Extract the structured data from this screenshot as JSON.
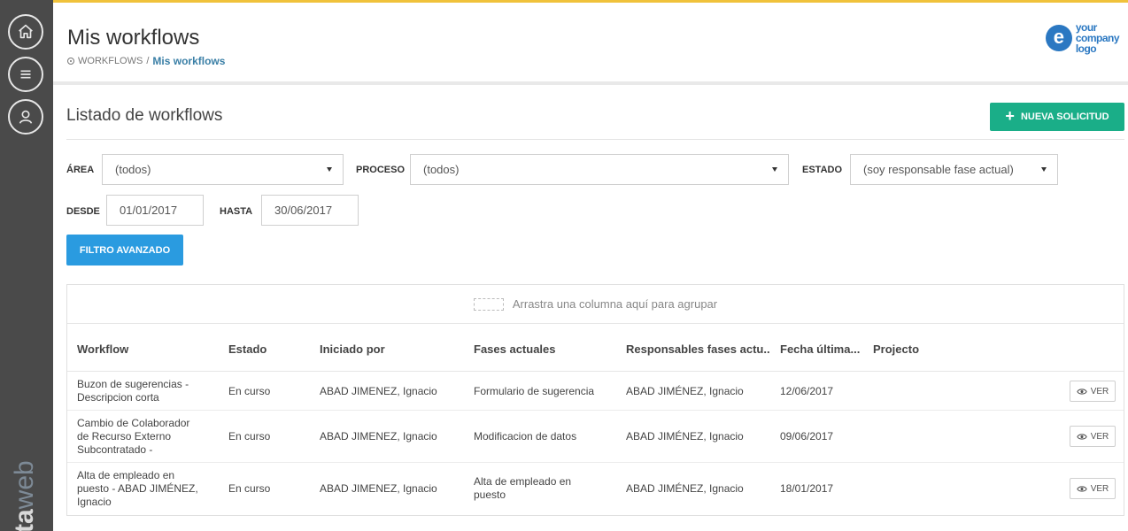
{
  "header": {
    "title": "Mis workflows",
    "breadcrumb_root": "WORKFLOWS",
    "breadcrumb_sep": "/",
    "breadcrumb_current": "Mis workflows",
    "logo_lines": [
      "your",
      "company",
      "logo"
    ],
    "logo_mark": "e"
  },
  "sidebar": {
    "icons": [
      "home-icon",
      "menu-icon",
      "user-icon"
    ],
    "brand_bold": "ta",
    "brand_light": "web"
  },
  "section": {
    "title": "Listado de workflows",
    "new_button": "NUEVA SOLICITUD",
    "new_button_icon": "+"
  },
  "filters": {
    "area_label": "ÁREA",
    "area_value": "(todos)",
    "proceso_label": "PROCESO",
    "proceso_value": "(todos)",
    "estado_label": "ESTADO",
    "estado_value": "(soy responsable fase actual)",
    "desde_label": "DESDE",
    "desde_value": "01/01/2017",
    "hasta_label": "HASTA",
    "hasta_value": "30/06/2017",
    "advanced_button": "FILTRO AVANZADO"
  },
  "grid": {
    "group_hint": "Arrastra una columna aquí para agrupar",
    "columns": [
      "Workflow",
      "Estado",
      "Iniciado por",
      "Fases actuales",
      "Responsables fases actu..",
      "Fecha última...",
      "Projecto"
    ],
    "view_label": "VER",
    "rows": [
      {
        "workflow": [
          "Buzon de sugerencias -",
          "Descripcion corta"
        ],
        "estado": "En curso",
        "iniciado": "ABAD JIMENEZ, Ignacio",
        "fases": [
          "Formulario de sugerencia"
        ],
        "responsables": "ABAD JIMÉNEZ, Ignacio",
        "fecha": "12/06/2017",
        "projecto": ""
      },
      {
        "workflow": [
          "Cambio de Colaborador",
          "de Recurso Externo",
          "Subcontratado -"
        ],
        "estado": "En curso",
        "iniciado": "ABAD JIMENEZ, Ignacio",
        "fases": [
          "Modificacion de datos"
        ],
        "responsables": "ABAD JIMÉNEZ, Ignacio",
        "fecha": "09/06/2017",
        "projecto": ""
      },
      {
        "workflow": [
          "Alta de empleado en",
          "puesto - ABAD JIMÉNEZ,",
          "Ignacio"
        ],
        "estado": "En curso",
        "iniciado": "ABAD JIMENEZ, Ignacio",
        "fases": [
          "Alta de empleado en",
          "puesto"
        ],
        "responsables": "ABAD JIMÉNEZ, Ignacio",
        "fecha": "18/01/2017",
        "projecto": ""
      }
    ]
  },
  "colors": {
    "sidebar": "#4a4a4a",
    "accent_top": "#f0c23b",
    "primary_green": "#1aae88",
    "primary_blue": "#2a9be0",
    "link": "#3a7fa6",
    "logo_blue": "#2b78c2"
  }
}
